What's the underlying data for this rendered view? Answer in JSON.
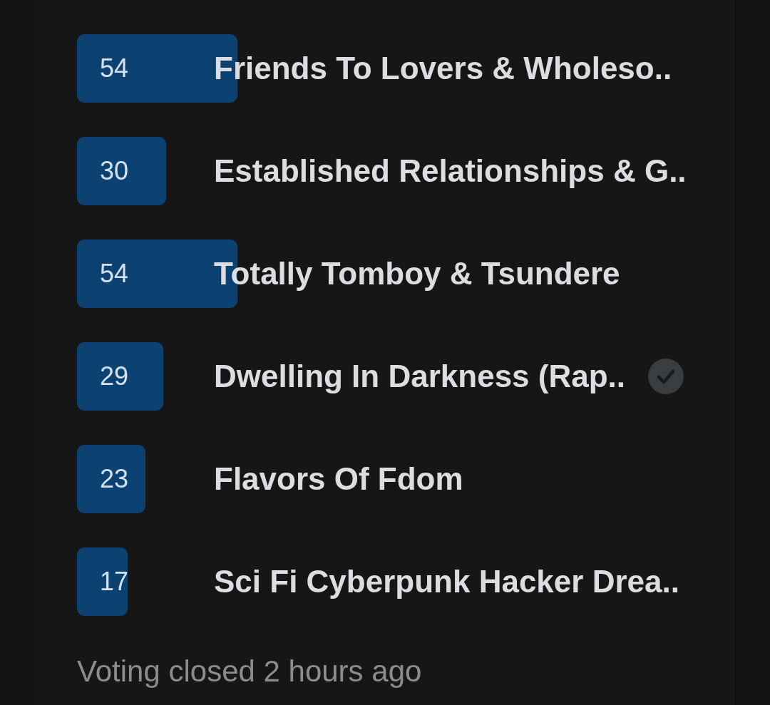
{
  "poll": {
    "options": [
      {
        "label": "Friends To Lovers & Wholeso..",
        "votes": "54",
        "voted": false
      },
      {
        "label": "Established Relationships & G..",
        "votes": "30",
        "voted": false
      },
      {
        "label": "Totally Tomboy & Tsundere",
        "votes": "54",
        "voted": false
      },
      {
        "label": "Dwelling In Darkness (Rap..",
        "votes": "29",
        "voted": true
      },
      {
        "label": "Flavors Of Fdom",
        "votes": "23",
        "voted": false
      },
      {
        "label": "Sci Fi Cyberpunk Hacker Drea..",
        "votes": "17",
        "voted": false
      }
    ],
    "footer": "Voting closed 2 hours ago"
  }
}
